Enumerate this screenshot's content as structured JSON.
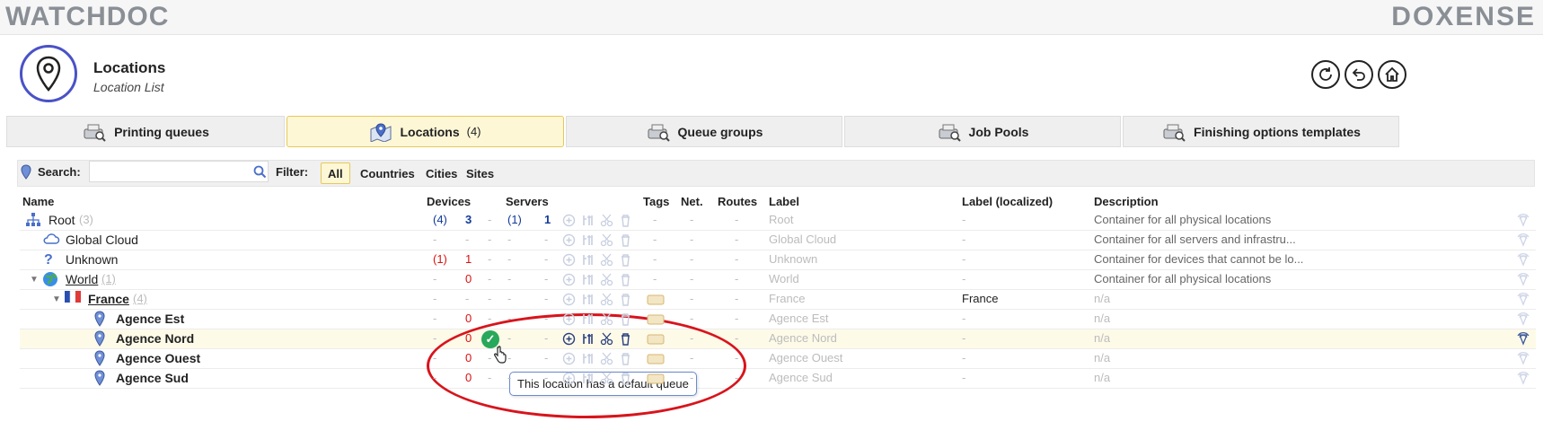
{
  "brand": {
    "left": "WATCHDOC",
    "right": "DOXENSE"
  },
  "header": {
    "title": "Locations",
    "subtitle": "Location List"
  },
  "tabs": [
    {
      "label": "Printing queues",
      "count": "",
      "icon": "printer-search-icon"
    },
    {
      "label": "Locations",
      "count": "(4)",
      "icon": "map-pin-icon"
    },
    {
      "label": "Queue groups",
      "count": "",
      "icon": "printer-search-icon"
    },
    {
      "label": "Job Pools",
      "count": "",
      "icon": "printer-search-icon"
    },
    {
      "label": "Finishing options templates",
      "count": "",
      "icon": "printer-search-icon"
    }
  ],
  "toolbar": {
    "search_label": "Search:",
    "search_value": "",
    "filter_label": "Filter:",
    "filters": [
      "All",
      "Countries",
      "Cities",
      "Sites"
    ],
    "selected_filter": "All"
  },
  "columns": {
    "name": "Name",
    "devices": "Devices",
    "servers": "Servers",
    "tags": "Tags",
    "net": "Net.",
    "routes": "Routes",
    "label": "Label",
    "label_localized": "Label (localized)",
    "description": "Description"
  },
  "rows": [
    {
      "name": "Root",
      "count": "(3)",
      "dev_paren": "(4)",
      "dev_num": "3",
      "srv_paren": "(1)",
      "srv_num": "1",
      "label": "Root",
      "label_localized": "-",
      "description": "Container for all physical locations"
    },
    {
      "name": "Global Cloud",
      "count": "",
      "dev_paren": "-",
      "dev_num": "-",
      "srv_paren": "-",
      "srv_num": "-",
      "label": "Global Cloud",
      "label_localized": "-",
      "description": "Container for all servers and infrastru..."
    },
    {
      "name": "Unknown",
      "count": "",
      "dev_paren": "(1)",
      "dev_num": "1",
      "srv_paren": "-",
      "srv_num": "-",
      "label": "Unknown",
      "label_localized": "-",
      "description": "Container for devices that cannot be lo..."
    },
    {
      "name": "World",
      "count": "(1)",
      "dev_paren": "-",
      "dev_num": "0",
      "srv_paren": "-",
      "srv_num": "-",
      "label": "World",
      "label_localized": "-",
      "description": "Container for all physical locations"
    },
    {
      "name": "France",
      "count": "(4)",
      "dev_paren": "-",
      "dev_num": "-",
      "srv_paren": "-",
      "srv_num": "-",
      "label": "France",
      "label_localized": "France",
      "description": "n/a"
    },
    {
      "name": "Agence Est",
      "count": "",
      "dev_paren": "-",
      "dev_num": "0",
      "srv_paren": "-",
      "srv_num": "-",
      "label": "Agence Est",
      "label_localized": "-",
      "description": "n/a"
    },
    {
      "name": "Agence Nord",
      "count": "",
      "dev_paren": "-",
      "dev_num": "0",
      "srv_paren": "-",
      "srv_num": "-",
      "label": "Agence Nord",
      "label_localized": "-",
      "description": "n/a"
    },
    {
      "name": "Agence Ouest",
      "count": "",
      "dev_paren": "-",
      "dev_num": "0",
      "srv_paren": "-",
      "srv_num": "-",
      "label": "Agence Ouest",
      "label_localized": "-",
      "description": "n/a"
    },
    {
      "name": "Agence Sud",
      "count": "",
      "dev_paren": "-",
      "dev_num": "0",
      "srv_paren": "-",
      "srv_num": "-",
      "label": "Agence Sud",
      "label_localized": "-",
      "description": "n/a"
    }
  ],
  "tooltip": "This location has a default queue",
  "colors": {
    "accent_tab": "#fdf7d6",
    "accent_border": "#e8c85a",
    "header_circle": "#4a52c6",
    "annotation_red": "#d8141c",
    "device_red": "#dd1111",
    "device_blue": "#123a9a"
  }
}
